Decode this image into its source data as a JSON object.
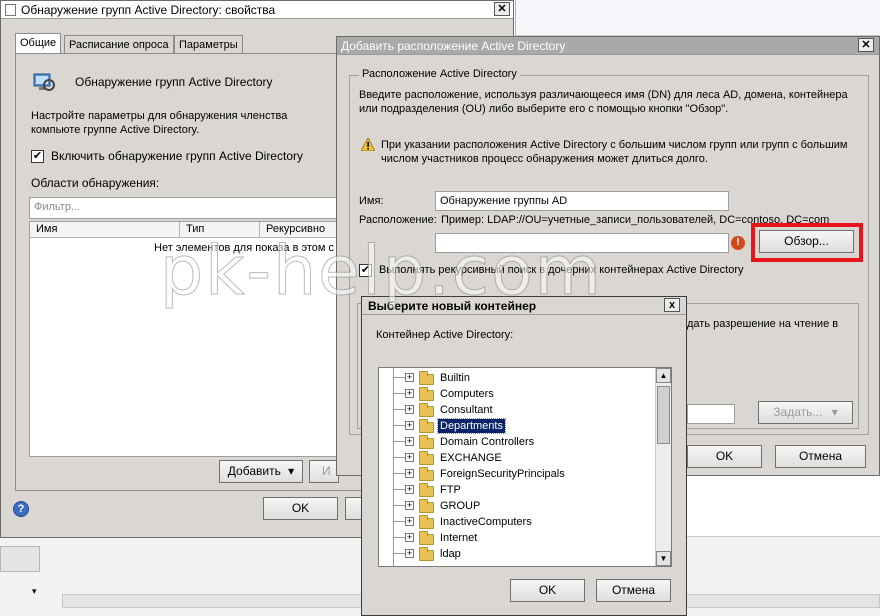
{
  "props_window": {
    "title": "Обнаружение групп Active Directory: свойства",
    "tabs": [
      "Общие",
      "Расписание опроса",
      "Параметры"
    ],
    "header_title": "Обнаружение групп Active Directory",
    "description": "Настройте параметры для обнаружения членства компьюте группе Active Directory.",
    "enable_checkbox_label": "Включить обнаружение групп Active Directory",
    "enable_checked": true,
    "scopes_label": "Области обнаружения:",
    "filter_placeholder": "Фильтр...",
    "columns": [
      "Имя",
      "Тип",
      "Рекурсивно"
    ],
    "empty_text": "Нет элементов для показа в этом с",
    "add_button": "Добавить",
    "add_arrow": "▾",
    "edit_button": "И",
    "ok_button": "OK",
    "help_icon_glyph": "?"
  },
  "add_location_window": {
    "title": "Добавить расположение Active Directory",
    "group_title": "Расположение Active Directory",
    "description": "Введите расположение, используя различающееся имя (DN) для леса AD, домена, контейнера или подразделения (OU) либо выберите его с помощью кнопки \"Обзор\".",
    "warning": "При указании расположения Active Directory с большим числом групп или групп с большим числом участников процесс обнаружения может длиться долго.",
    "name_label": "Имя:",
    "name_value": "Обнаружение группы AD",
    "location_label": "Расположение:",
    "location_example": "Пример: LDAP://OU=учетные_записи_пользователей, DC=contoso, DC=com",
    "location_value": "",
    "error_glyph": "!",
    "browse_button": "Обзор...",
    "recursive_label": "Выполнять рекурсивный поиск в дочерних контейнерах Active Directory",
    "recursive_checked": true,
    "partial_text": "дать разрешение на чтение в",
    "set_button": "Задать...",
    "ok_button": "OK",
    "cancel_button": "Отмена",
    "highlight_color": "#e8141c"
  },
  "container_dialog": {
    "title": "Выберите новый контейнер",
    "label": "Контейнер Active Directory:",
    "items": [
      {
        "label": "Builtin",
        "selected": false
      },
      {
        "label": "Computers",
        "selected": false
      },
      {
        "label": "Consultant",
        "selected": false
      },
      {
        "label": "Departments",
        "selected": true
      },
      {
        "label": "Domain Controllers",
        "selected": false
      },
      {
        "label": "EXCHANGE",
        "selected": false
      },
      {
        "label": "ForeignSecurityPrincipals",
        "selected": false
      },
      {
        "label": "FTP",
        "selected": false
      },
      {
        "label": "GROUP",
        "selected": false
      },
      {
        "label": "InactiveComputers",
        "selected": false
      },
      {
        "label": "Internet",
        "selected": false
      },
      {
        "label": "ldap",
        "selected": false
      }
    ],
    "ok_button": "OK",
    "cancel_button": "Отмена",
    "close_glyph": "x"
  },
  "watermark": "pk-help.com"
}
